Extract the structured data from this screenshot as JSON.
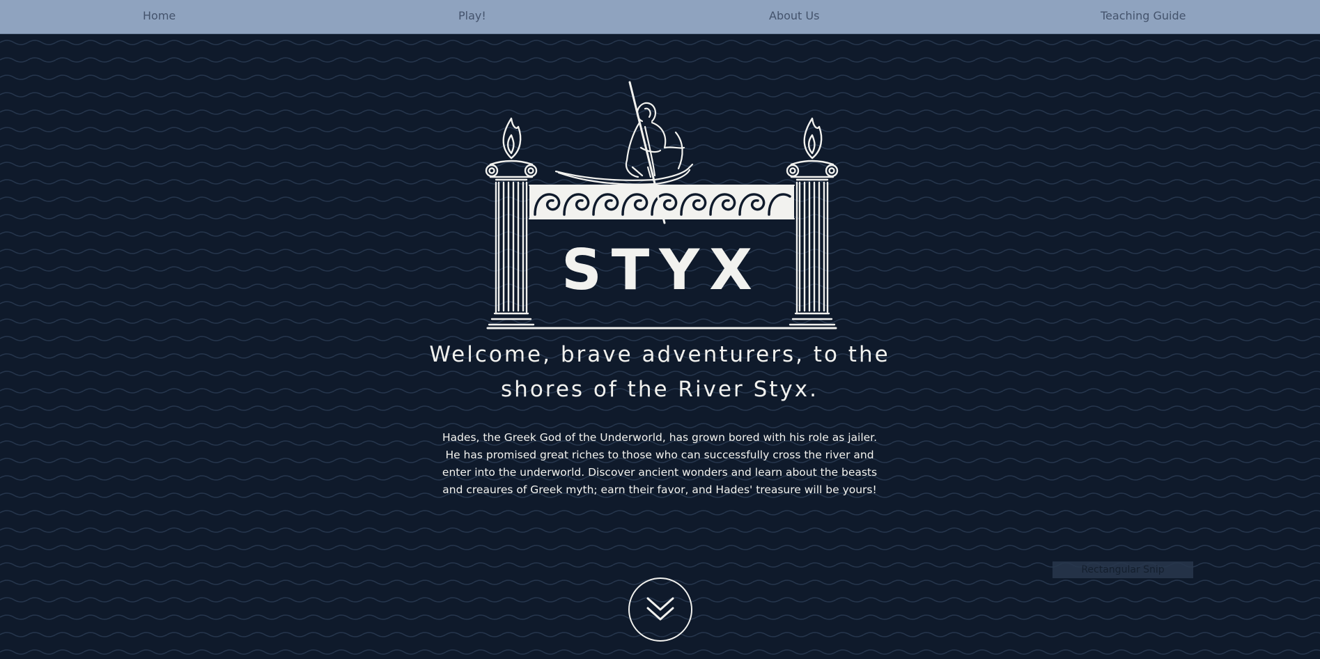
{
  "nav": {
    "home": "Home",
    "play": "Play!",
    "about": "About Us",
    "teaching_guide": "Teaching Guide"
  },
  "logo": {
    "title": "STYX",
    "icon": "charon-boat-pillars-logo"
  },
  "hero": {
    "welcome_line1": "Welcome, brave adventurers, to the",
    "welcome_line2": "shores of the River Styx.",
    "intro": "Hades, the Greek God of the Underworld, has grown bored with his role as jailer. He has promised great riches to those who can successfully cross the river and enter into the underworld. Discover ancient wonders and learn about the beasts and creaures of Greek myth; earn their favor, and Hades' treasure will be yours!"
  },
  "scroll": {
    "icon": "double-chevron-down-icon"
  },
  "overlay": {
    "snip_label": "Rectangular Snip"
  },
  "colors": {
    "background": "#0f1a2b",
    "navbar": "#8fa3bf",
    "nav_text": "#44536c",
    "foreground": "#f2f2ef"
  }
}
